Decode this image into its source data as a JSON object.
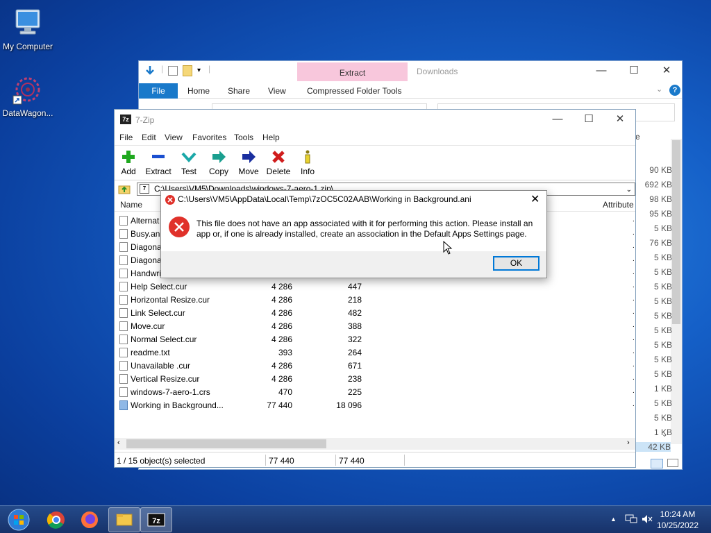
{
  "desktop": {
    "icons": [
      {
        "label": "My Computer",
        "icon": "computer-icon"
      },
      {
        "label": "DataWagon...",
        "icon": "app-shortcut-icon"
      }
    ]
  },
  "explorer": {
    "title": "Downloads",
    "context_tab": "Extract",
    "tabs": [
      "File",
      "Home",
      "Share",
      "View",
      "Compressed Folder Tools"
    ],
    "sizes": [
      "90 KB",
      "692 KB",
      "98 KB",
      "95 KB",
      "5 KB",
      "76 KB",
      "5 KB",
      "5 KB",
      "5 KB",
      "5 KB",
      "5 KB",
      "5 KB",
      "5 KB",
      "5 KB",
      "5 KB",
      "1 KB",
      "5 KB",
      "5 KB",
      "1 KB",
      "42 KB"
    ],
    "partial_header": "e",
    "accent": "#1979ca",
    "extract_band_color": "#f8c7dc"
  },
  "zip": {
    "title": "7-Zip",
    "menu": [
      "File",
      "Edit",
      "View",
      "Favorites",
      "Tools",
      "Help"
    ],
    "toolbar": [
      {
        "label": "Add",
        "icon": "add-icon"
      },
      {
        "label": "Extract",
        "icon": "extract-icon"
      },
      {
        "label": "Test",
        "icon": "test-icon"
      },
      {
        "label": "Copy",
        "icon": "copy-icon"
      },
      {
        "label": "Move",
        "icon": "move-icon"
      },
      {
        "label": "Delete",
        "icon": "delete-icon"
      },
      {
        "label": "Info",
        "icon": "info-icon"
      }
    ],
    "path": "C:\\Users\\VM5\\Downloads\\windows-7-aero-1.zip\\",
    "columns": {
      "name": "Name",
      "attributes": "Attribute"
    },
    "files": [
      {
        "name": "Alternat",
        "size": "",
        "packed": ""
      },
      {
        "name": "Busy.ani",
        "size": "",
        "packed": ""
      },
      {
        "name": "Diagona",
        "size": "",
        "packed": ""
      },
      {
        "name": "Diagona",
        "size": "",
        "packed": ""
      },
      {
        "name": "Handwri",
        "size": "",
        "packed": ""
      },
      {
        "name": "Help Select.cur",
        "size": "4 286",
        "packed": "447"
      },
      {
        "name": "Horizontal Resize.cur",
        "size": "4 286",
        "packed": "218"
      },
      {
        "name": "Link Select.cur",
        "size": "4 286",
        "packed": "482"
      },
      {
        "name": "Move.cur",
        "size": "4 286",
        "packed": "388"
      },
      {
        "name": "Normal Select.cur",
        "size": "4 286",
        "packed": "322"
      },
      {
        "name": "readme.txt",
        "size": "393",
        "packed": "264"
      },
      {
        "name": "Unavailable .cur",
        "size": "4 286",
        "packed": "671"
      },
      {
        "name": "Vertical Resize.cur",
        "size": "4 286",
        "packed": "238"
      },
      {
        "name": "windows-7-aero-1.crs",
        "size": "470",
        "packed": "225"
      },
      {
        "name": "Working in Background...",
        "size": "77 440",
        "packed": "18 096"
      }
    ],
    "status": {
      "selection": "1 / 15 object(s) selected",
      "size": "77 440",
      "packed": "77 440"
    }
  },
  "dialog": {
    "title": "C:\\Users\\VM5\\AppData\\Local\\Temp\\7zOC5C02AAB\\Working in Background.ani",
    "message": "This file does not have an app associated with it for performing this action. Please install an app or, if one is already installed, create an association in the Default Apps Settings page.",
    "ok": "OK",
    "error_color": "#e0312a"
  },
  "taskbar": {
    "time": "10:24 AM",
    "date": "10/25/2022",
    "apps": [
      "start-orb-icon",
      "chrome-icon",
      "firefox-icon",
      "file-explorer-icon",
      "7zip-icon"
    ]
  }
}
